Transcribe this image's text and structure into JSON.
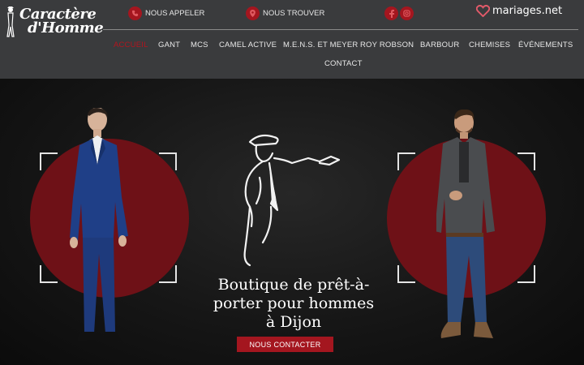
{
  "header": {
    "logo": {
      "line1": "Caractère",
      "line2": "d'Homme"
    },
    "call_label": "NOUS APPELER",
    "find_label": "NOUS TROUVER",
    "social": [
      "facebook-icon",
      "instagram-icon"
    ],
    "partner_logo": "mariages.net"
  },
  "nav": {
    "items": [
      "ACCUEIL",
      "GANT",
      "MCS",
      "CAMEL ACTIVE",
      "M.E.N.S. ET MEYER",
      "ROY ROBSON",
      "BARBOUR",
      "CHEMISES",
      "ÉVÉNEMENTS",
      "CONTACT"
    ],
    "active": "ACCUEIL"
  },
  "hero": {
    "title": "Boutique de prêt-à-porter pour hommes à Dijon",
    "cta_label": "NOUS CONTACTER"
  },
  "colors": {
    "header_bg": "#3a3b3d",
    "accent": "#a4161f",
    "circle": "#6e1117",
    "hero_bg": "#141414"
  }
}
